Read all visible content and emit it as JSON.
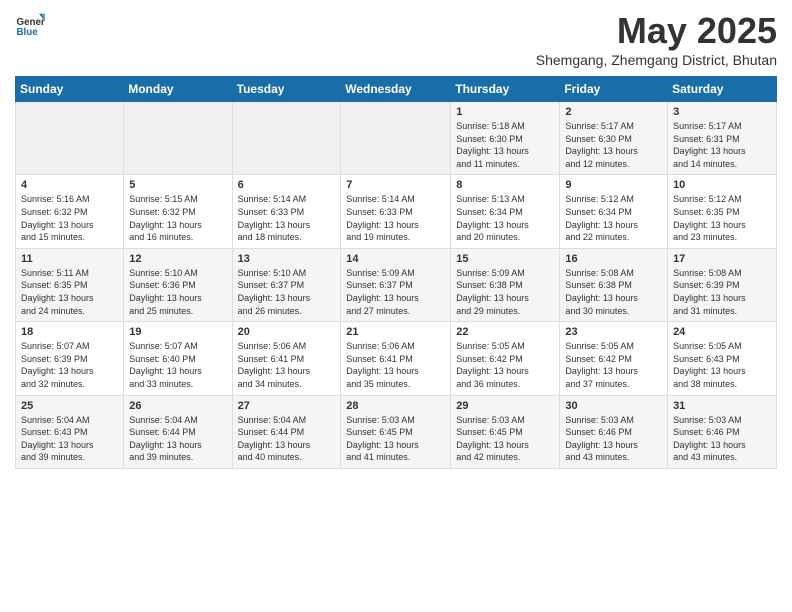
{
  "logo": {
    "general": "General",
    "blue": "Blue"
  },
  "title": {
    "month_year": "May 2025",
    "location": "Shemgang, Zhemgang District, Bhutan"
  },
  "weekdays": [
    "Sunday",
    "Monday",
    "Tuesday",
    "Wednesday",
    "Thursday",
    "Friday",
    "Saturday"
  ],
  "weeks": [
    [
      {
        "day": "",
        "content": ""
      },
      {
        "day": "",
        "content": ""
      },
      {
        "day": "",
        "content": ""
      },
      {
        "day": "",
        "content": ""
      },
      {
        "day": "1",
        "content": "Sunrise: 5:18 AM\nSunset: 6:30 PM\nDaylight: 13 hours\nand 11 minutes."
      },
      {
        "day": "2",
        "content": "Sunrise: 5:17 AM\nSunset: 6:30 PM\nDaylight: 13 hours\nand 12 minutes."
      },
      {
        "day": "3",
        "content": "Sunrise: 5:17 AM\nSunset: 6:31 PM\nDaylight: 13 hours\nand 14 minutes."
      }
    ],
    [
      {
        "day": "4",
        "content": "Sunrise: 5:16 AM\nSunset: 6:32 PM\nDaylight: 13 hours\nand 15 minutes."
      },
      {
        "day": "5",
        "content": "Sunrise: 5:15 AM\nSunset: 6:32 PM\nDaylight: 13 hours\nand 16 minutes."
      },
      {
        "day": "6",
        "content": "Sunrise: 5:14 AM\nSunset: 6:33 PM\nDaylight: 13 hours\nand 18 minutes."
      },
      {
        "day": "7",
        "content": "Sunrise: 5:14 AM\nSunset: 6:33 PM\nDaylight: 13 hours\nand 19 minutes."
      },
      {
        "day": "8",
        "content": "Sunrise: 5:13 AM\nSunset: 6:34 PM\nDaylight: 13 hours\nand 20 minutes."
      },
      {
        "day": "9",
        "content": "Sunrise: 5:12 AM\nSunset: 6:34 PM\nDaylight: 13 hours\nand 22 minutes."
      },
      {
        "day": "10",
        "content": "Sunrise: 5:12 AM\nSunset: 6:35 PM\nDaylight: 13 hours\nand 23 minutes."
      }
    ],
    [
      {
        "day": "11",
        "content": "Sunrise: 5:11 AM\nSunset: 6:35 PM\nDaylight: 13 hours\nand 24 minutes."
      },
      {
        "day": "12",
        "content": "Sunrise: 5:10 AM\nSunset: 6:36 PM\nDaylight: 13 hours\nand 25 minutes."
      },
      {
        "day": "13",
        "content": "Sunrise: 5:10 AM\nSunset: 6:37 PM\nDaylight: 13 hours\nand 26 minutes."
      },
      {
        "day": "14",
        "content": "Sunrise: 5:09 AM\nSunset: 6:37 PM\nDaylight: 13 hours\nand 27 minutes."
      },
      {
        "day": "15",
        "content": "Sunrise: 5:09 AM\nSunset: 6:38 PM\nDaylight: 13 hours\nand 29 minutes."
      },
      {
        "day": "16",
        "content": "Sunrise: 5:08 AM\nSunset: 6:38 PM\nDaylight: 13 hours\nand 30 minutes."
      },
      {
        "day": "17",
        "content": "Sunrise: 5:08 AM\nSunset: 6:39 PM\nDaylight: 13 hours\nand 31 minutes."
      }
    ],
    [
      {
        "day": "18",
        "content": "Sunrise: 5:07 AM\nSunset: 6:39 PM\nDaylight: 13 hours\nand 32 minutes."
      },
      {
        "day": "19",
        "content": "Sunrise: 5:07 AM\nSunset: 6:40 PM\nDaylight: 13 hours\nand 33 minutes."
      },
      {
        "day": "20",
        "content": "Sunrise: 5:06 AM\nSunset: 6:41 PM\nDaylight: 13 hours\nand 34 minutes."
      },
      {
        "day": "21",
        "content": "Sunrise: 5:06 AM\nSunset: 6:41 PM\nDaylight: 13 hours\nand 35 minutes."
      },
      {
        "day": "22",
        "content": "Sunrise: 5:05 AM\nSunset: 6:42 PM\nDaylight: 13 hours\nand 36 minutes."
      },
      {
        "day": "23",
        "content": "Sunrise: 5:05 AM\nSunset: 6:42 PM\nDaylight: 13 hours\nand 37 minutes."
      },
      {
        "day": "24",
        "content": "Sunrise: 5:05 AM\nSunset: 6:43 PM\nDaylight: 13 hours\nand 38 minutes."
      }
    ],
    [
      {
        "day": "25",
        "content": "Sunrise: 5:04 AM\nSunset: 6:43 PM\nDaylight: 13 hours\nand 39 minutes."
      },
      {
        "day": "26",
        "content": "Sunrise: 5:04 AM\nSunset: 6:44 PM\nDaylight: 13 hours\nand 39 minutes."
      },
      {
        "day": "27",
        "content": "Sunrise: 5:04 AM\nSunset: 6:44 PM\nDaylight: 13 hours\nand 40 minutes."
      },
      {
        "day": "28",
        "content": "Sunrise: 5:03 AM\nSunset: 6:45 PM\nDaylight: 13 hours\nand 41 minutes."
      },
      {
        "day": "29",
        "content": "Sunrise: 5:03 AM\nSunset: 6:45 PM\nDaylight: 13 hours\nand 42 minutes."
      },
      {
        "day": "30",
        "content": "Sunrise: 5:03 AM\nSunset: 6:46 PM\nDaylight: 13 hours\nand 43 minutes."
      },
      {
        "day": "31",
        "content": "Sunrise: 5:03 AM\nSunset: 6:46 PM\nDaylight: 13 hours\nand 43 minutes."
      }
    ]
  ]
}
